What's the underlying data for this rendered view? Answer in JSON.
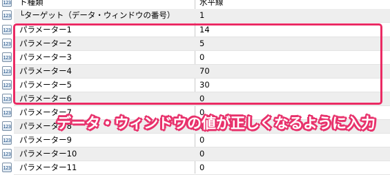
{
  "properties": {
    "icon": "numeric-123-icon",
    "rows": [
      {
        "name": "ト種類",
        "value": "水平線"
      },
      {
        "name": "└ターゲット（データ・ウィンドウの番号）",
        "value": "1"
      },
      {
        "name": "パラメーター1",
        "value": "14"
      },
      {
        "name": "パラメーター2",
        "value": "5"
      },
      {
        "name": "パラメーター3",
        "value": "0"
      },
      {
        "name": "パラメーター4",
        "value": "70"
      },
      {
        "name": "パラメーター5",
        "value": "30"
      },
      {
        "name": "パラメーター6",
        "value": "0"
      },
      {
        "name": "パラメーター7",
        "value": "0"
      },
      {
        "name": "パラメーター8",
        "value": "0"
      },
      {
        "name": "パラメーター9",
        "value": "0"
      },
      {
        "name": "パラメーター10",
        "value": "0"
      },
      {
        "name": "パラメーター11",
        "value": "0"
      }
    ]
  },
  "annotation": {
    "caption": "データ・ウィンドウの値が正しくなるように入力",
    "color": "#ea2a63"
  },
  "icon_text": "123"
}
